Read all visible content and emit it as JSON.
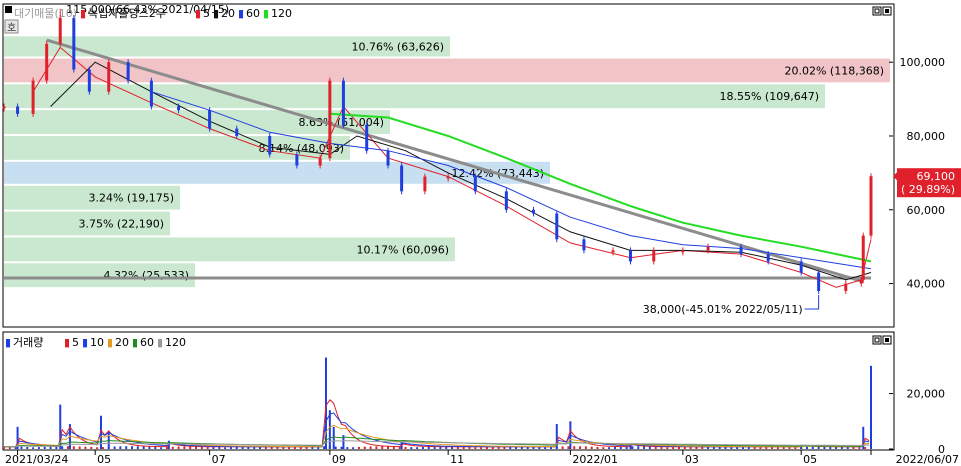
{
  "main_legend": {
    "volume_profile": "대기매물(10)",
    "instrument": "녹십자홀딩스2우",
    "ma_labels": [
      "5",
      "20",
      "60",
      "120"
    ]
  },
  "volume_legend": {
    "title": "거래량",
    "ma_labels": [
      "5",
      "10",
      "20",
      "60",
      "120"
    ]
  },
  "colors": {
    "up": "#e0202b",
    "down": "#1f3ee0",
    "ma5": "#e0202b",
    "ma20": "#111111",
    "ma60": "#1f3ee0",
    "ma120": "#22dd22",
    "trend": "#8c8c8c",
    "band_green": "#c9e8cf",
    "band_red": "#f1c4c8",
    "band_blue": "#c7dff0",
    "vol_ma5": "#e0202b",
    "vol_ma10": "#1f3ee0",
    "vol_ma20": "#e69a1f",
    "vol_ma60": "#228b22",
    "vol_ma120": "#9a9a9a"
  },
  "chart_data": [
    {
      "type": "candlestick",
      "name": "price",
      "y_ticks": [
        40000,
        60000,
        80000,
        100000
      ],
      "y_tick_labels": [
        "40,000",
        "60,000",
        "80,000",
        "100,000"
      ],
      "ylim": [
        28500,
        115500
      ],
      "x_ticks": [
        {
          "date": "2021-03-24",
          "label": "2021/03/24"
        },
        {
          "date": "2021-05-03",
          "label": "05"
        },
        {
          "date": "2021-07-01",
          "label": "07"
        },
        {
          "date": "2021-09-01",
          "label": "09"
        },
        {
          "date": "2021-11-01",
          "label": "11"
        },
        {
          "date": "2022-01-03",
          "label": "2022/01"
        },
        {
          "date": "2022-03-02",
          "label": "03"
        },
        {
          "date": "2022-05-02",
          "label": "05"
        },
        {
          "date": "2022-06-07",
          "label": "2022/06/07"
        }
      ],
      "x_range": [
        "2021-03-17",
        "2022-06-07"
      ],
      "price_series": [
        {
          "date": "2021-03-17",
          "close": 88000
        },
        {
          "date": "2021-03-24",
          "close": 86000
        },
        {
          "date": "2021-04-01",
          "close": 95000
        },
        {
          "date": "2021-04-08",
          "close": 105000
        },
        {
          "date": "2021-04-15",
          "close": 112000
        },
        {
          "date": "2021-04-22",
          "close": 98000
        },
        {
          "date": "2021-04-30",
          "close": 92000
        },
        {
          "date": "2021-05-10",
          "close": 100000
        },
        {
          "date": "2021-05-20",
          "close": 95000
        },
        {
          "date": "2021-06-01",
          "close": 88000
        },
        {
          "date": "2021-06-15",
          "close": 87000
        },
        {
          "date": "2021-07-01",
          "close": 82000
        },
        {
          "date": "2021-07-15",
          "close": 80000
        },
        {
          "date": "2021-08-01",
          "close": 75000
        },
        {
          "date": "2021-08-15",
          "close": 72000
        },
        {
          "date": "2021-08-27",
          "close": 74000
        },
        {
          "date": "2021-09-01",
          "close": 95000
        },
        {
          "date": "2021-09-08",
          "close": 83000
        },
        {
          "date": "2021-09-20",
          "close": 76000
        },
        {
          "date": "2021-10-01",
          "close": 72000
        },
        {
          "date": "2021-10-08",
          "close": 65000
        },
        {
          "date": "2021-10-20",
          "close": 69000
        },
        {
          "date": "2021-11-01",
          "close": 69000
        },
        {
          "date": "2021-11-15",
          "close": 65000
        },
        {
          "date": "2021-12-01",
          "close": 60000
        },
        {
          "date": "2021-12-15",
          "close": 59000
        },
        {
          "date": "2021-12-27",
          "close": 52000
        },
        {
          "date": "2022-01-10",
          "close": 49000
        },
        {
          "date": "2022-01-25",
          "close": 49000
        },
        {
          "date": "2022-02-03",
          "close": 46000
        },
        {
          "date": "2022-02-15",
          "close": 49000
        },
        {
          "date": "2022-03-02",
          "close": 49000
        },
        {
          "date": "2022-03-15",
          "close": 50000
        },
        {
          "date": "2022-04-01",
          "close": 48000
        },
        {
          "date": "2022-04-15",
          "close": 46000
        },
        {
          "date": "2022-05-02",
          "close": 43000
        },
        {
          "date": "2022-05-11",
          "close": 38000
        },
        {
          "date": "2022-05-25",
          "close": 40000
        },
        {
          "date": "2022-06-02",
          "close": 41000
        },
        {
          "date": "2022-06-03",
          "close": 53000
        },
        {
          "date": "2022-06-07",
          "close": 69100
        }
      ],
      "ma_series": [
        {
          "name": "5",
          "points": [
            [
              "2021-04-01",
              92000
            ],
            [
              "2021-04-15",
              104000
            ],
            [
              "2021-05-03",
              96000
            ],
            [
              "2021-06-01",
              89000
            ],
            [
              "2021-07-01",
              82000
            ],
            [
              "2021-08-01",
              76000
            ],
            [
              "2021-08-27",
              74000
            ],
            [
              "2021-09-08",
              88000
            ],
            [
              "2021-10-01",
              74000
            ],
            [
              "2021-11-01",
              69000
            ],
            [
              "2021-12-01",
              61000
            ],
            [
              "2022-01-03",
              51000
            ],
            [
              "2022-02-03",
              47000
            ],
            [
              "2022-03-02",
              49000
            ],
            [
              "2022-04-01",
              48000
            ],
            [
              "2022-05-02",
              43000
            ],
            [
              "2022-05-20",
              39000
            ],
            [
              "2022-06-02",
              41000
            ],
            [
              "2022-06-07",
              52000
            ]
          ]
        },
        {
          "name": "20",
          "points": [
            [
              "2021-04-10",
              88000
            ],
            [
              "2021-05-03",
              100000
            ],
            [
              "2021-06-01",
              92000
            ],
            [
              "2021-07-01",
              84000
            ],
            [
              "2021-08-01",
              77000
            ],
            [
              "2021-09-01",
              75000
            ],
            [
              "2021-09-15",
              80000
            ],
            [
              "2021-10-10",
              76000
            ],
            [
              "2021-11-01",
              70000
            ],
            [
              "2021-12-01",
              63000
            ],
            [
              "2022-01-03",
              54000
            ],
            [
              "2022-02-03",
              49000
            ],
            [
              "2022-03-02",
              49000
            ],
            [
              "2022-04-01",
              48500
            ],
            [
              "2022-05-02",
              45000
            ],
            [
              "2022-05-25",
              41000
            ],
            [
              "2022-06-07",
              43000
            ]
          ]
        },
        {
          "name": "60",
          "points": [
            [
              "2021-06-01",
              92000
            ],
            [
              "2021-07-01",
              87000
            ],
            [
              "2021-08-01",
              81000
            ],
            [
              "2021-09-01",
              78000
            ],
            [
              "2021-10-01",
              76000
            ],
            [
              "2021-11-01",
              72000
            ],
            [
              "2021-12-01",
              66000
            ],
            [
              "2022-01-03",
              58000
            ],
            [
              "2022-02-03",
              53000
            ],
            [
              "2022-03-02",
              50500
            ],
            [
              "2022-04-01",
              49500
            ],
            [
              "2022-05-02",
              47000
            ],
            [
              "2022-06-07",
              44000
            ]
          ]
        },
        {
          "name": "120",
          "points": [
            [
              "2021-09-01",
              86000
            ],
            [
              "2021-10-01",
              85000
            ],
            [
              "2021-11-01",
              80000
            ],
            [
              "2021-12-01",
              74000
            ],
            [
              "2022-01-03",
              67000
            ],
            [
              "2022-02-03",
              61000
            ],
            [
              "2022-03-02",
              56500
            ],
            [
              "2022-04-01",
              53000
            ],
            [
              "2022-05-02",
              50000
            ],
            [
              "2022-06-07",
              46000
            ]
          ]
        }
      ],
      "trendline": {
        "from": [
          "2021-04-08",
          106000
        ],
        "to": [
          "2022-06-03",
          40500
        ]
      },
      "support_line": 41500,
      "bands": [
        {
          "label": "10.76% (63,626)",
          "low": 101000,
          "high": 107000,
          "color": "band_green"
        },
        {
          "label": "20.02% (118,368)",
          "low": 94000,
          "high": 101000,
          "color": "band_red"
        },
        {
          "label": "18.55% (109,647)",
          "low": 87000,
          "high": 94000,
          "color": "band_green"
        },
        {
          "label": "8.63% (51,004)",
          "low": 80000,
          "high": 87000,
          "color": "band_green"
        },
        {
          "label": "8.14% (48,093)",
          "low": 73000,
          "high": 80000,
          "color": "band_green"
        },
        {
          "label": "12.42% (73,443)",
          "low": 66500,
          "high": 73000,
          "color": "band_blue"
        },
        {
          "label": "3.24% (19,175)",
          "low": 59500,
          "high": 66500,
          "color": "band_green"
        },
        {
          "label": "3.75% (22,190)",
          "low": 52500,
          "high": 59500,
          "color": "band_green"
        },
        {
          "label": "10.17% (60,096)",
          "low": 45500,
          "high": 52500,
          "color": "band_green"
        },
        {
          "label": "4.32% (25,533)",
          "low": 38500,
          "high": 45500,
          "color": "band_green"
        }
      ],
      "annotations": [
        {
          "text": "115,000(66.43% 2021/04/15)",
          "date": "2021-04-15",
          "value": 115000
        },
        {
          "text": "38,000(-45.01% 2022/05/11)",
          "date": "2022-05-11",
          "value": 38000
        }
      ],
      "current_price": {
        "value": 69100,
        "label": "69,100",
        "change": "( 29.89%)"
      }
    },
    {
      "type": "bar",
      "name": "volume",
      "y_ticks": [
        0,
        20000
      ],
      "y_tick_labels": [
        "0",
        "20,000"
      ],
      "ylim": [
        0,
        35000
      ],
      "spikes": [
        {
          "date": "2021-03-24",
          "value": 8000
        },
        {
          "date": "2021-04-15",
          "value": 16000
        },
        {
          "date": "2021-04-20",
          "value": 9000
        },
        {
          "date": "2021-05-06",
          "value": 12000
        },
        {
          "date": "2021-05-10",
          "value": 6000
        },
        {
          "date": "2021-06-10",
          "value": 3000
        },
        {
          "date": "2021-08-30",
          "value": 33000
        },
        {
          "date": "2021-09-01",
          "value": 14000
        },
        {
          "date": "2021-09-03",
          "value": 8000
        },
        {
          "date": "2021-09-08",
          "value": 5000
        },
        {
          "date": "2021-10-08",
          "value": 2500
        },
        {
          "date": "2021-12-27",
          "value": 9000
        },
        {
          "date": "2022-01-03",
          "value": 10000
        },
        {
          "date": "2022-02-03",
          "value": 2000
        },
        {
          "date": "2022-05-02",
          "value": 1500
        },
        {
          "date": "2022-06-03",
          "value": 8000
        },
        {
          "date": "2022-06-07",
          "value": 30000
        }
      ]
    }
  ]
}
